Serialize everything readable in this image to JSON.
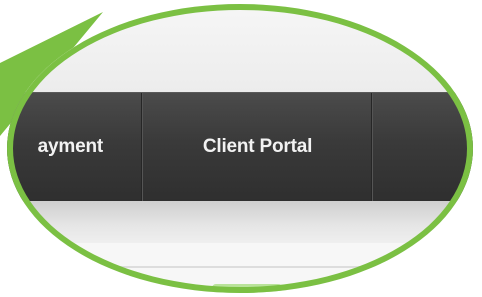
{
  "callout": {
    "ring_color": "#7bc043"
  },
  "navbar": {
    "items": [
      {
        "label": "ayment"
      },
      {
        "label": "Client Portal"
      },
      {
        "label": ""
      }
    ],
    "background": "#3a3a3a",
    "text_color": "#f2f2f2"
  }
}
